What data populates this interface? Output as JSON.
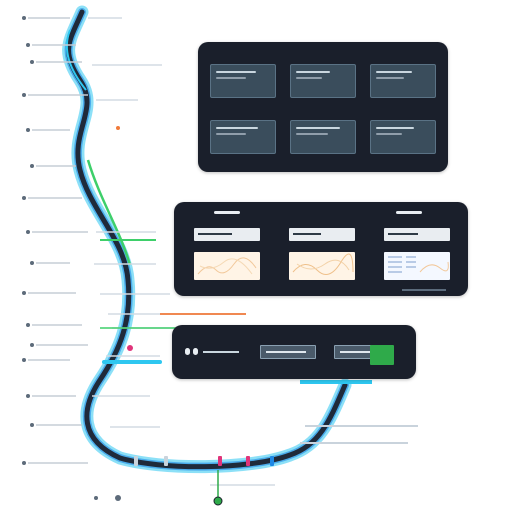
{
  "colors": {
    "track_dark": "#1f2a3a",
    "track_cyan": "#2ec7f0",
    "track_blue": "#1e88e5",
    "track_green": "#3ecf6a",
    "panel_bg": "#1a1f2b",
    "card_bg": "#3a4d5c",
    "accent_orange": "#f07a3a",
    "accent_magenta": "#e0347a",
    "accent_green": "#2faa4a"
  },
  "icons": {
    "route_start": "dot-icon",
    "route_end": "pin-icon"
  }
}
